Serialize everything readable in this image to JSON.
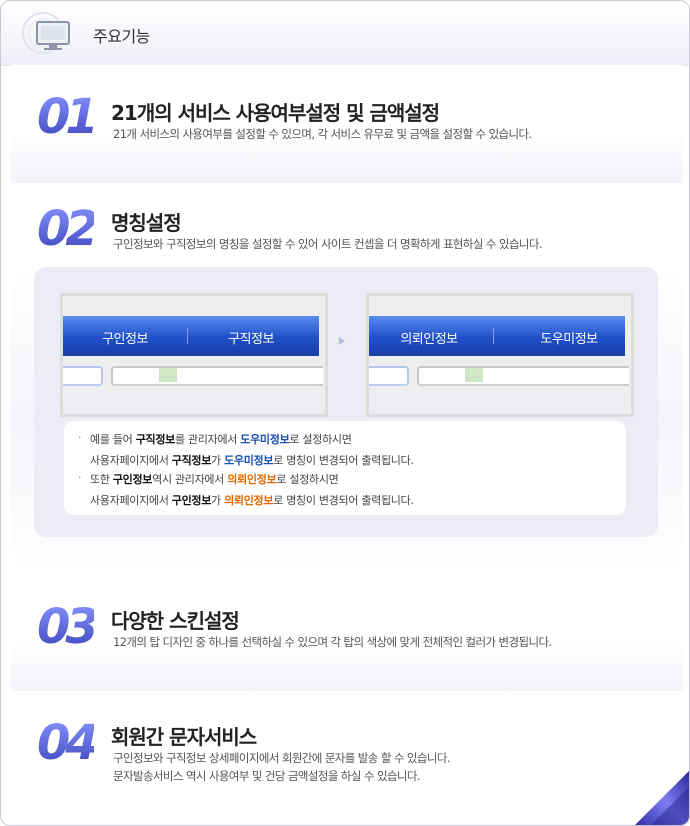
{
  "header": {
    "title": "주요기능",
    "icon": "monitor-icon"
  },
  "features": [
    {
      "num": "01",
      "title": "21개의 서비스 사용여부설정 및 금액설정",
      "desc": [
        "21개 서비스의 사용여부를 설정할 수 있으며, 각 서비스 유무료 및 금액을 설정할 수 있습니다."
      ]
    },
    {
      "num": "02",
      "title": "명칭설정",
      "desc": [
        "구인정보와 구직정보의 명칭을 설정할 수 있어 사이트 컨셉을 더 명확하게 표현하실 수 있습니다."
      ]
    },
    {
      "num": "03",
      "title": "다양한 스킨설정",
      "desc": [
        "12개의 탑 디자인 중 하나를 선택하실 수 있으며 각 탑의 색상에 맞게 전체적인 컬러가 변경됩니다."
      ]
    },
    {
      "num": "04",
      "title": "회원간 문자서비스",
      "desc": [
        "구인정보와 구직정보 상세페이지에서 회원간에 문자를 발송 할 수 있습니다.",
        "문자발송서비스 역시 사용여부 및 건당 금액설정을 하실 수 있습니다."
      ]
    }
  ],
  "demo": {
    "before_tabs": [
      "구인정보",
      "구직정보"
    ],
    "after_tabs": [
      "의뢰인정보",
      "도우미정보"
    ]
  },
  "notes": {
    "l1": {
      "a": "예를 들어 ",
      "b": "구직정보",
      "c": "를 관리자에서 ",
      "d": "도우미정보",
      "e": "로 설정하시면"
    },
    "l2": {
      "a": "사용자페이지에서 ",
      "b": "구직정보",
      "c": "가 ",
      "d": "도우미정보",
      "e": "로 명칭이 변경되어 출력됩니다."
    },
    "l3": {
      "a": "또한 ",
      "b": "구인정보",
      "c": "역시 관리자에서 ",
      "d": "의뢰인정보",
      "e": "로 설정하시면"
    },
    "l4": {
      "a": "사용자페이지에서 ",
      "b": "구인정보",
      "c": "가 ",
      "d": "의뢰인정보",
      "e": "로 명칭이 변경되어 출력됩니다."
    },
    "bullet": "·"
  },
  "colors": {
    "accent_blue": "#1a4fb0",
    "accent_orange": "#e06a00",
    "tab_bar": "#1f4fc8",
    "number": "#4a56c9"
  }
}
